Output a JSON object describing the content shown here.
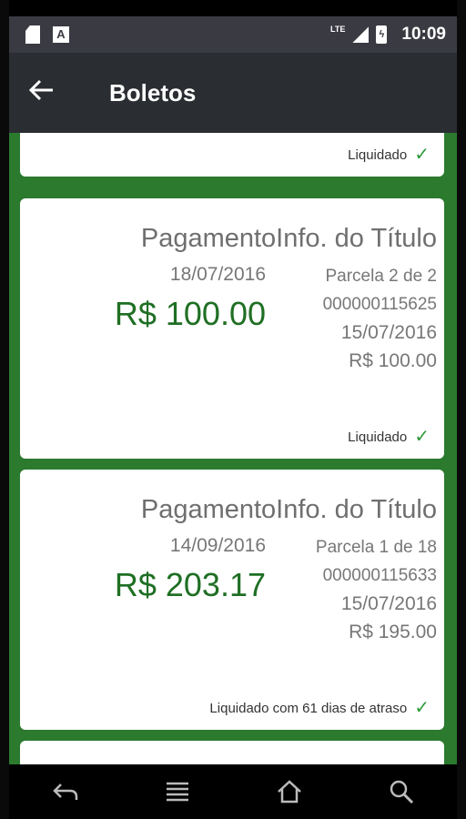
{
  "statusbar": {
    "network": "LTE",
    "battery_glyph": "ϟ",
    "time": "10:09",
    "app_icon_letter": "A"
  },
  "appbar": {
    "back_icon": "arrow-left-icon",
    "title": "Boletos"
  },
  "cards": [
    {
      "status": "Liquidado"
    },
    {
      "title": "PagamentoInfo. do Título",
      "payment_date": "18/07/2016",
      "payment_amount": "R$ 100.00",
      "parcela": "Parcela 2 de 2",
      "numero": "000000115625",
      "vencimento": "15/07/2016",
      "valor": "R$ 100.00",
      "status": "Liquidado"
    },
    {
      "title": "PagamentoInfo. do Título",
      "payment_date": "14/09/2016",
      "payment_amount": "R$ 203.17",
      "parcela": "Parcela 1 de 18",
      "numero": "000000115633",
      "vencimento": "15/07/2016",
      "valor": "R$ 195.00",
      "status": "Liquidado com 61 dias de atraso"
    }
  ],
  "check_glyph": "✓",
  "colors": {
    "accent_green": "#2b7a2e",
    "amount_green": "#1f6f24",
    "check_green": "#2e9b3a",
    "appbar": "#2a2d31"
  },
  "navbar": {
    "icons": [
      "back-icon",
      "menu-icon",
      "home-icon",
      "search-icon"
    ]
  }
}
